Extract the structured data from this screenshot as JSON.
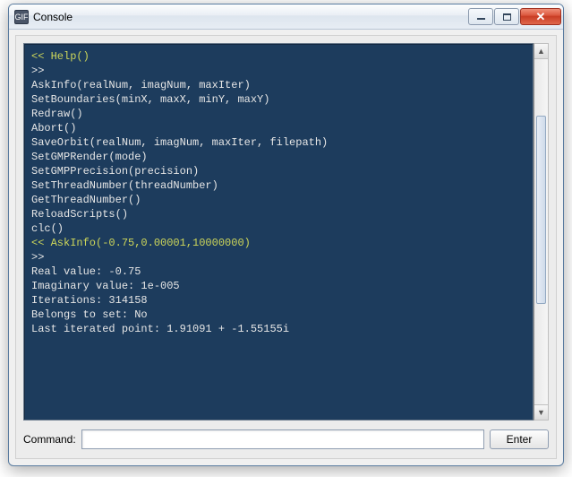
{
  "window": {
    "title": "Console",
    "app_icon_text": "GIF"
  },
  "console": {
    "lines": [
      {
        "cls": "cmd",
        "text": "<< Help()"
      },
      {
        "cls": "",
        "text": ">>"
      },
      {
        "cls": "",
        "text": "AskInfo(realNum, imagNum, maxIter)"
      },
      {
        "cls": "",
        "text": "SetBoundaries(minX, maxX, minY, maxY)"
      },
      {
        "cls": "",
        "text": "Redraw()"
      },
      {
        "cls": "",
        "text": "Abort()"
      },
      {
        "cls": "",
        "text": "SaveOrbit(realNum, imagNum, maxIter, filepath)"
      },
      {
        "cls": "",
        "text": "SetGMPRender(mode)"
      },
      {
        "cls": "",
        "text": "SetGMPPrecision(precision)"
      },
      {
        "cls": "",
        "text": "SetThreadNumber(threadNumber)"
      },
      {
        "cls": "",
        "text": "GetThreadNumber()"
      },
      {
        "cls": "",
        "text": "ReloadScripts()"
      },
      {
        "cls": "",
        "text": "clc()"
      },
      {
        "cls": "",
        "text": ""
      },
      {
        "cls": "cmd",
        "text": "<< AskInfo(-0.75,0.00001,10000000)"
      },
      {
        "cls": "",
        "text": ">>"
      },
      {
        "cls": "",
        "text": "Real value: -0.75"
      },
      {
        "cls": "",
        "text": "Imaginary value: 1e-005"
      },
      {
        "cls": "",
        "text": "Iterations: 314158"
      },
      {
        "cls": "",
        "text": "Belongs to set: No"
      },
      {
        "cls": "",
        "text": "Last iterated point: 1.91091 + -1.55155i"
      }
    ]
  },
  "command_row": {
    "label": "Command:",
    "input_value": "",
    "placeholder": "",
    "enter_label": "Enter"
  }
}
